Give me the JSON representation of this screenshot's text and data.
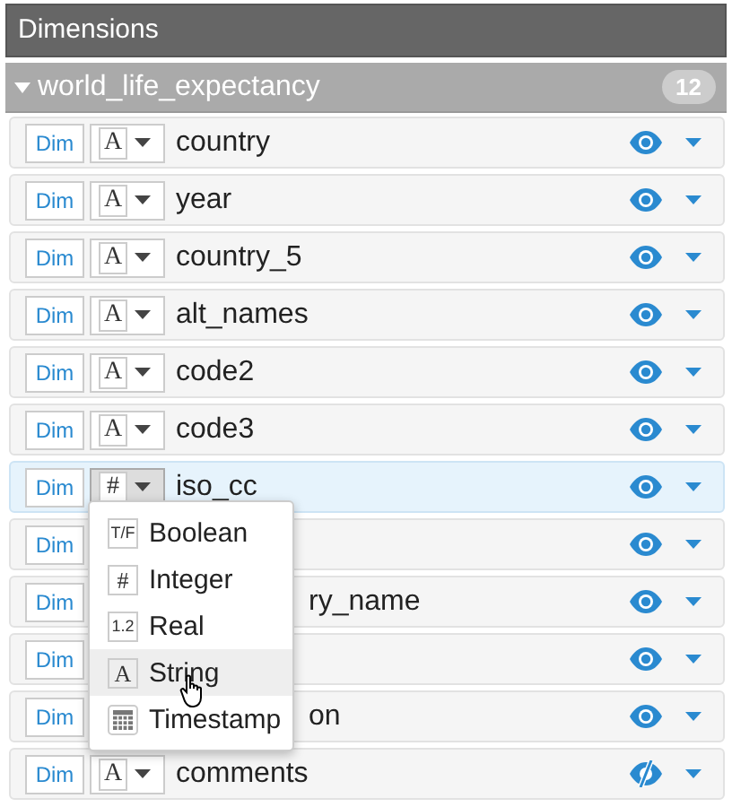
{
  "panel": {
    "title": "Dimensions"
  },
  "group": {
    "name": "world_life_expectancy",
    "count": "12",
    "expanded": true
  },
  "rows": [
    {
      "dim": "Dim",
      "type_glyph": "A",
      "name": "country",
      "visible": true,
      "highlighted": false
    },
    {
      "dim": "Dim",
      "type_glyph": "A",
      "name": "year",
      "visible": true,
      "highlighted": false
    },
    {
      "dim": "Dim",
      "type_glyph": "A",
      "name": "country_5",
      "visible": true,
      "highlighted": false
    },
    {
      "dim": "Dim",
      "type_glyph": "A",
      "name": "alt_names",
      "visible": true,
      "highlighted": false
    },
    {
      "dim": "Dim",
      "type_glyph": "A",
      "name": "code2",
      "visible": true,
      "highlighted": false
    },
    {
      "dim": "Dim",
      "type_glyph": "A",
      "name": "code3",
      "visible": true,
      "highlighted": false
    },
    {
      "dim": "Dim",
      "type_glyph": "#",
      "name": "iso_cc",
      "visible": true,
      "highlighted": true
    },
    {
      "dim": "Dim",
      "visible": true,
      "highlighted": false
    },
    {
      "dim": "Dim",
      "name": "ry_name",
      "visible": true,
      "highlighted": false
    },
    {
      "dim": "Dim",
      "visible": true,
      "highlighted": false
    },
    {
      "dim": "Dim",
      "name": "on",
      "visible": true,
      "highlighted": false
    },
    {
      "dim": "Dim",
      "type_glyph": "A",
      "name": "comments",
      "visible": false,
      "highlighted": false
    }
  ],
  "type_menu": {
    "items": [
      {
        "kind": "boolean",
        "glyph": "T/F",
        "label": "Boolean",
        "selected": false
      },
      {
        "kind": "integer",
        "glyph": "#",
        "label": "Integer",
        "selected": false
      },
      {
        "kind": "real",
        "glyph": "1.2",
        "label": "Real",
        "selected": false
      },
      {
        "kind": "string",
        "glyph": "A",
        "label": "String",
        "selected": true
      },
      {
        "kind": "timestamp",
        "label": "Timestamp",
        "selected": false
      }
    ]
  }
}
